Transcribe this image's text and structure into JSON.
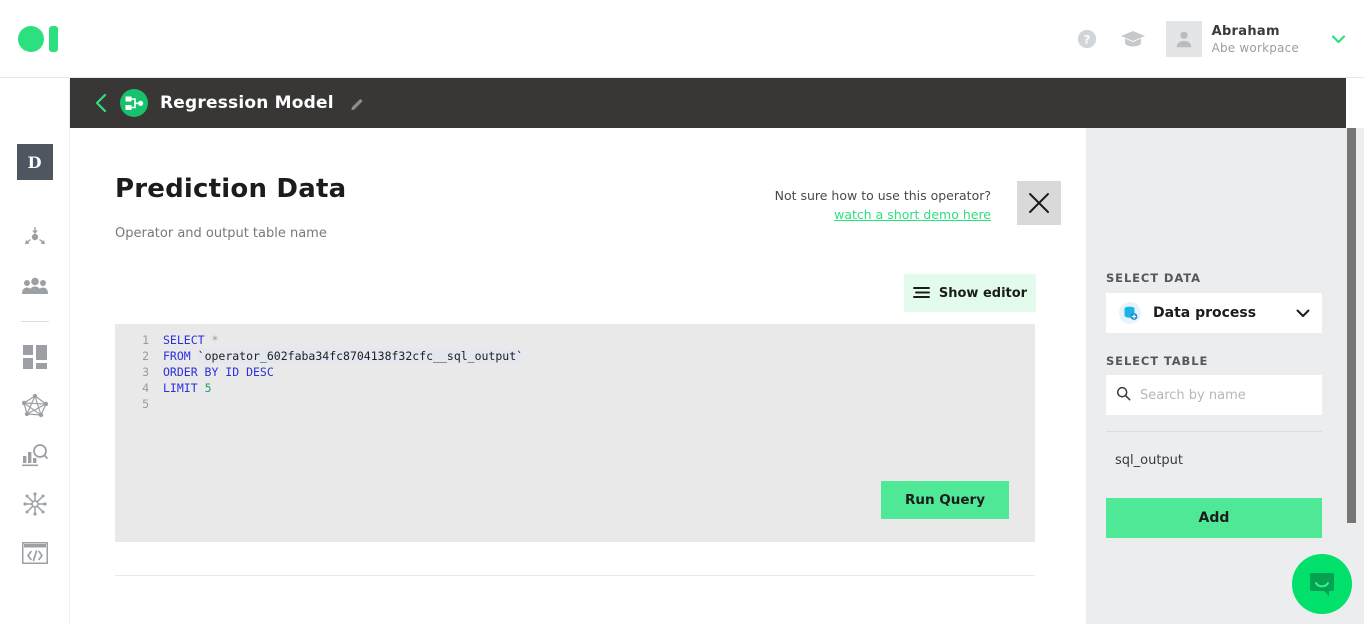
{
  "topbar": {
    "logo_name": "logo",
    "help_icon": "help-circle-icon",
    "learn_icon": "graduation-cap-icon",
    "user": {
      "name": "Abraham",
      "workspace": "Abe workpace",
      "avatar_icon": "user-avatar-icon",
      "caret_icon": "chevron-down-icon"
    }
  },
  "darkbar": {
    "back_icon": "chevron-left-icon",
    "model_icon": "model-flow-icon",
    "title": "Regression Model",
    "edit_icon": "pencil-icon"
  },
  "rail": {
    "badge": "D",
    "items": [
      {
        "name": "data-import-icon"
      },
      {
        "name": "people-icon"
      },
      {
        "name": "dashboard-grid-icon"
      },
      {
        "name": "network-graph-icon"
      },
      {
        "name": "analytics-search-icon"
      },
      {
        "name": "neural-brain-icon"
      },
      {
        "name": "code-window-icon"
      }
    ]
  },
  "main": {
    "title": "Prediction Data",
    "subtitle": "Operator and output table name",
    "help_question": "Not sure how to use this operator?",
    "help_link": "watch a short demo here",
    "close_icon": "close-icon",
    "show_editor": {
      "label": "Show editor",
      "icon": "editor-lines-icon"
    },
    "run_query_label": "Run Query",
    "code": {
      "lines": [
        "1",
        "2",
        "3",
        "4",
        "5"
      ],
      "line1_kw": "SELECT",
      "line1_star": "*",
      "line2_kw": "FROM",
      "line2_table": "`operator_602faba34fc8704138f32cfc__sql_output`",
      "line3_kw": "ORDER BY ID DESC",
      "line4_kw": "LIMIT",
      "line4_num": "5"
    }
  },
  "right_panel": {
    "select_data_label": "SELECT DATA",
    "select_data_value": "Data process",
    "select_data_icon": "database-add-icon",
    "select_data_caret": "chevron-down-icon",
    "select_table_label": "SELECT TABLE",
    "search_placeholder": "Search by name",
    "search_value": "",
    "search_icon": "search-icon",
    "tables": [
      "sql_output"
    ],
    "add_label": "Add"
  },
  "chat": {
    "icon": "chat-bubble-icon"
  },
  "colors": {
    "accent_green": "#2ce07f",
    "button_green": "#4fe896",
    "dark_bar": "#383735",
    "panel_bg": "#ecedef",
    "editor_bg": "#e9e9e9",
    "keyword_blue": "#2b2fe0"
  }
}
